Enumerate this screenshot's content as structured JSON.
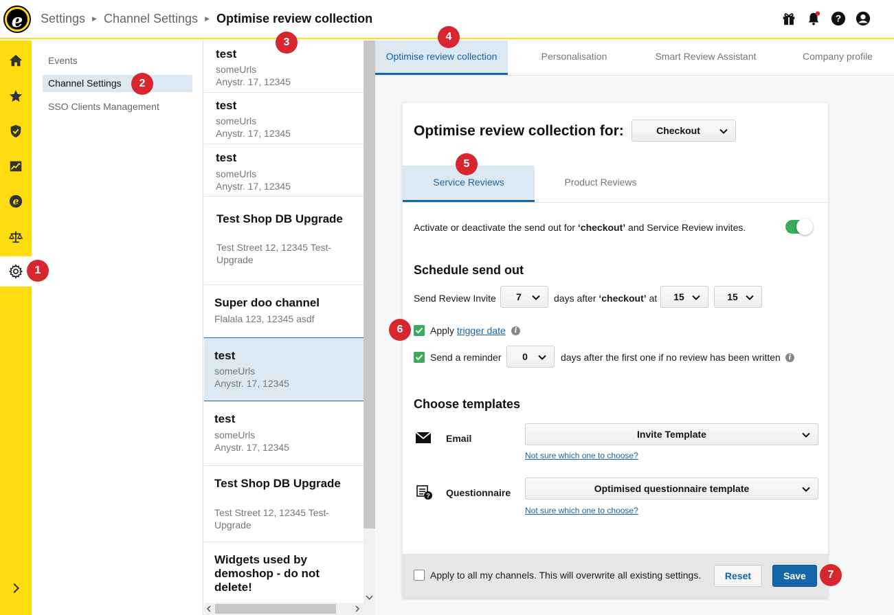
{
  "header": {
    "logo_letter": "e",
    "breadcrumb": [
      "Settings",
      "Channel Settings",
      "Optimise review collection"
    ],
    "icons": [
      "gift-icon",
      "bell-icon",
      "help-icon",
      "user-icon"
    ]
  },
  "rail": {
    "items": [
      "home-icon",
      "star-icon",
      "shield-check-icon",
      "chart-icon",
      "etrusted-icon",
      "scales-icon",
      "gear-icon"
    ],
    "expand_icon": "chevron-right-icon"
  },
  "nav": {
    "items": [
      "Events",
      "Channel Settings",
      "SSO Clients Management"
    ],
    "active_index": 1
  },
  "channels": [
    {
      "name": "test",
      "lines": [
        "someUrls",
        "Anystr. 17, 12345"
      ]
    },
    {
      "name": "test",
      "lines": [
        "someUrls",
        "Anystr. 17, 12345"
      ]
    },
    {
      "name": "test",
      "lines": [
        "someUrls",
        "Anystr. 17, 12345"
      ]
    },
    {
      "name": "Test Shop DB Upgrade",
      "lines": [
        "Test Street 12, 12345 Test-",
        "Upgrade"
      ]
    },
    {
      "name": "Super doo channel",
      "lines": [
        "Flalala 123, 12345 asdf"
      ]
    },
    {
      "name": "test",
      "lines": [
        "someUrls",
        "Anystr. 17, 12345"
      ],
      "active": true
    },
    {
      "name": "test",
      "lines": [
        "someUrls",
        "Anystr. 17, 12345"
      ]
    },
    {
      "name": "Test Shop DB Upgrade",
      "lines": [
        "Test Street 12, 12345 Test-",
        "Upgrade"
      ]
    },
    {
      "name_lines": [
        "Widgets used by",
        "demoshop - do not",
        "delete!"
      ]
    }
  ],
  "tabs": [
    "Optimise review collection",
    "Personalisation",
    "Smart Review Assistant",
    "Company profile"
  ],
  "card": {
    "title": "Optimise review collection for:",
    "event_select": "Checkout",
    "inner_tabs": [
      "Service Reviews",
      "Product Reviews"
    ],
    "activate_text_pre": "Activate or deactivate the send out for ",
    "activate_text_bold": "‘checkout’",
    "activate_text_post": " and Service Review invites.",
    "toggle_on": true,
    "schedule_heading": "Schedule send out",
    "send_invite_label": "Send Review Invite",
    "days_value": "7",
    "days_after_pre": "days after ",
    "days_after_bold": "‘checkout’",
    "days_after_post": " at",
    "hour_value": "15",
    "minute_value": "15",
    "apply_label": "Apply ",
    "trigger_date_link": "trigger date",
    "apply_checked": true,
    "reminder_label": "Send a reminder",
    "reminder_value": "0",
    "reminder_after": "days after the first one if no review has been written",
    "reminder_checked": true,
    "templates_heading": "Choose templates",
    "email_label": "Email",
    "email_template": "Invite Template",
    "email_help": "Not sure which one to choose?",
    "questionnaire_label": "Questionnaire",
    "questionnaire_template": "Optimised questionnaire template",
    "questionnaire_help": "Not sure which one to choose?",
    "apply_all_label": "Apply to all my channels. This will overwrite all existing settings.",
    "apply_all_checked": false,
    "reset_label": "Reset",
    "save_label": "Save"
  },
  "badges": [
    "1",
    "2",
    "3",
    "4",
    "5",
    "6",
    "7"
  ],
  "colors": {
    "brand_yellow": "#ffdc0f",
    "accent_blue": "#1565a8",
    "active_bg": "#dce9f2",
    "badge_red": "#d8262f",
    "toggle_green": "#3aab5a"
  }
}
